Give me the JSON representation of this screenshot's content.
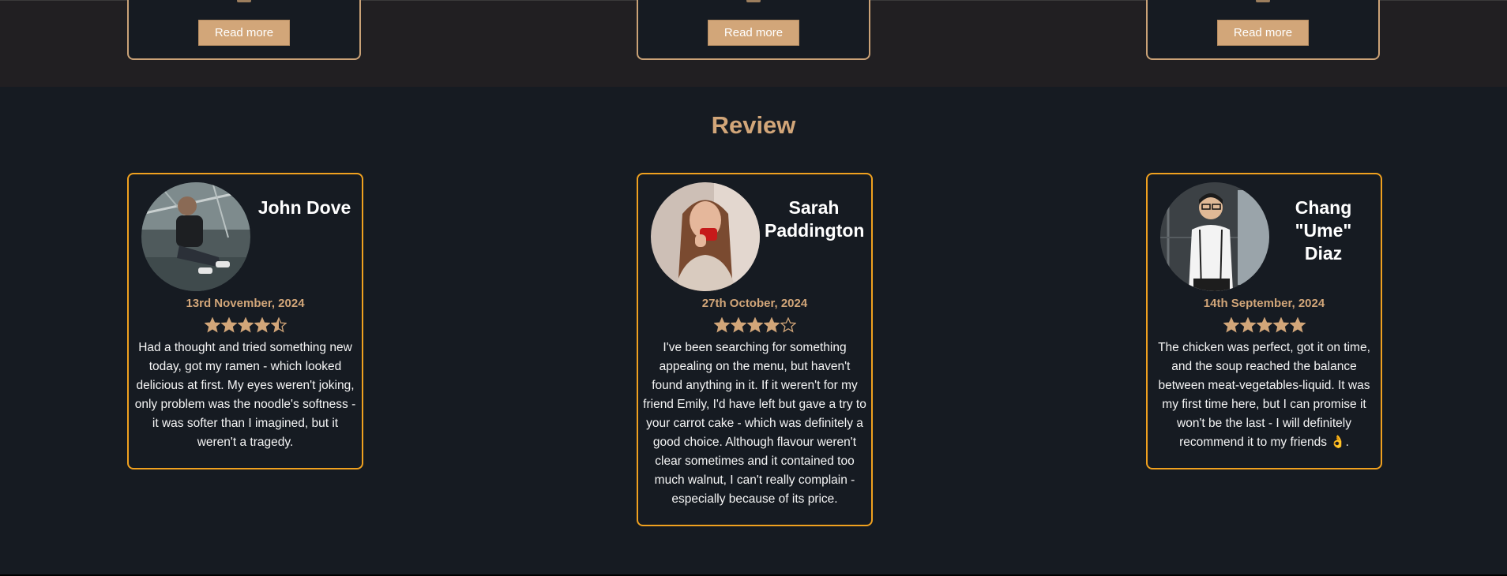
{
  "top_cards": [
    {
      "read_more_label": "Read more"
    },
    {
      "read_more_label": "Read more"
    },
    {
      "read_more_label": "Read more"
    }
  ],
  "review_section": {
    "title": "Review",
    "reviews": [
      {
        "name": "John Dove",
        "date": "13rd November, 2024",
        "rating": 4.5,
        "text": "Had a thought and tried something new today, got my ramen - which looked delicious at first. My eyes weren't joking, only problem was the noodle's softness - it was softer than I imagined, but it weren't a tragedy."
      },
      {
        "name": "Sarah Paddington",
        "date": "27th October, 2024",
        "rating": 4,
        "text": "I've been searching for something appealing on the menu, but haven't found anything in it. If it weren't for my friend Emily, I'd have left but gave a try to your carrot cake - which was definitely a good choice. Although flavour weren't clear sometimes and it contained too much walnut, I can't really complain - especially because of its price."
      },
      {
        "name": "Chang \"Ume\" Diaz",
        "date": "14th September, 2024",
        "rating": 5,
        "text": "The chicken was perfect, got it on time, and the soup reached the balance between meat-vegetables-liquid. It was my first time here, but I can promise it won't be the last - I will definitely recommend it to my friends 👌."
      }
    ]
  },
  "colors": {
    "accent": "#d2a679",
    "card_border": "#f0a11f",
    "background": "#161b22",
    "top_section_bg": "#211f22"
  }
}
